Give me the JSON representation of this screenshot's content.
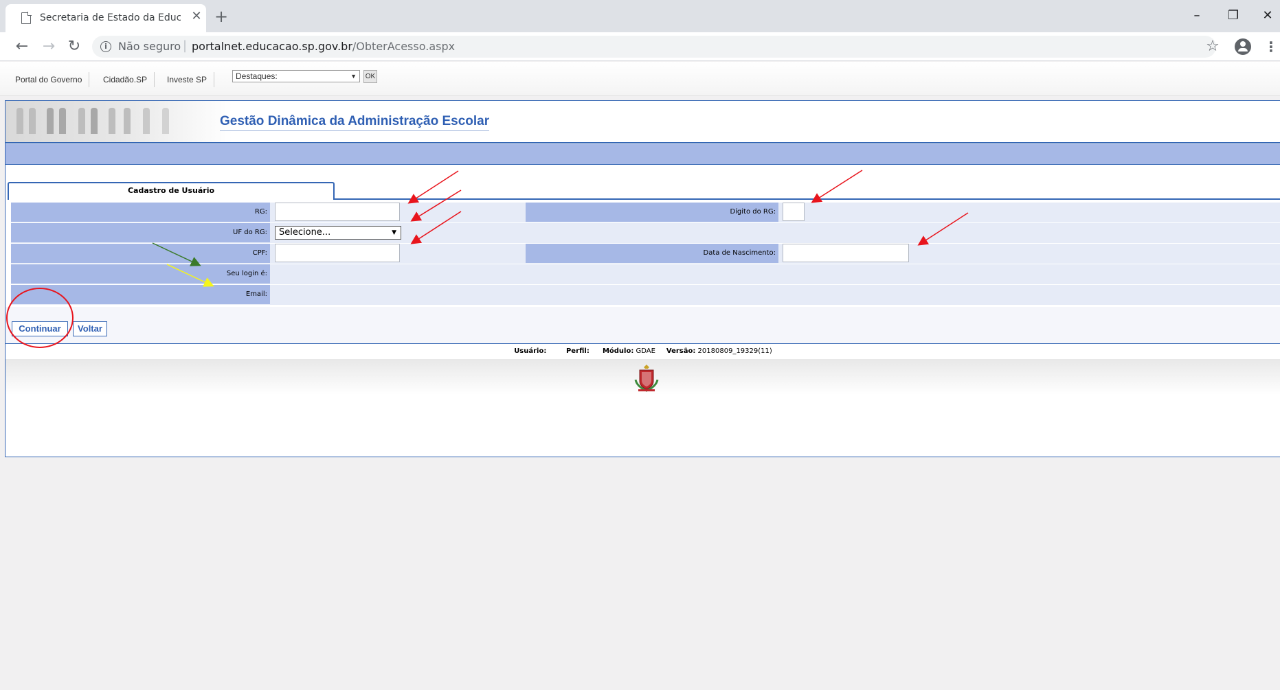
{
  "browser": {
    "tab_title": "Secretaria de Estado da Educação",
    "tab_close": "✕",
    "new_tab": "+",
    "not_secure": "Não seguro",
    "url_host": "portalnet.educacao.sp.gov.br",
    "url_path": "/ObterAcesso.aspx",
    "icons": [
      "page-icon",
      "back-arrow-icon",
      "forward-arrow-icon",
      "reload-icon",
      "info-icon",
      "star-icon",
      "account-icon",
      "menu-icon",
      "minimize-icon",
      "restore-icon",
      "close-icon"
    ]
  },
  "topbar": {
    "links": [
      "Portal do Governo",
      "Cidadão.SP",
      "Investe SP"
    ],
    "destaques_value": "Destaques:",
    "ok_label": "OK"
  },
  "app": {
    "title": "Gestão Dinâmica da Administração Escolar",
    "tab_label": "Cadastro de Usuário"
  },
  "form": {
    "rg_label": "RG:",
    "digito_label": "Dígito do RG:",
    "uf_label": "UF do RG:",
    "uf_value": "Selecione...",
    "cpf_label": "CPF:",
    "nascimento_label": "Data de Nascimento:",
    "login_label": "Seu login é:",
    "email_label": "Email:"
  },
  "buttons": {
    "continuar": "Continuar",
    "voltar": "Voltar"
  },
  "status": {
    "usuario_label": "Usuário:",
    "perfil_label": "Perfil:",
    "modulo_label": "Módulo:",
    "modulo_value": "GDAE",
    "versao_label": "Versão:",
    "versao_value": "20180809_19329(11)"
  },
  "colors": {
    "accent_blue": "#3466b4",
    "label_bg": "#a6b8e6",
    "row_bg": "#e6ebf7",
    "annotation_red": "#e8141c",
    "annotation_green": "#3b7a2a",
    "annotation_yellow": "#f5f51a"
  }
}
